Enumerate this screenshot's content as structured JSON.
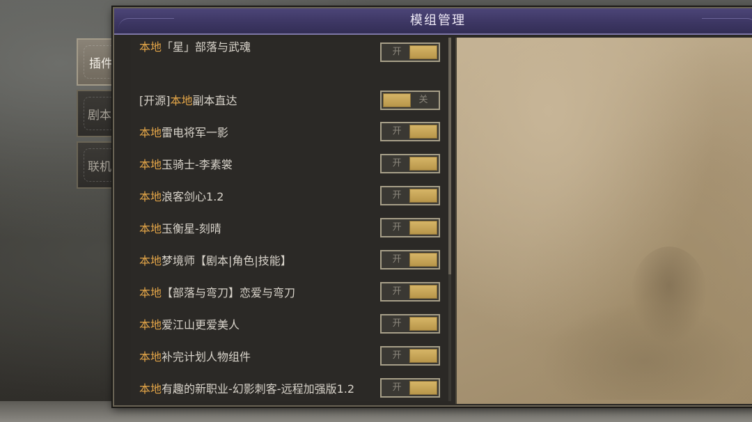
{
  "window": {
    "title": "模组管理"
  },
  "tabs": [
    {
      "label": "插件",
      "active": true
    },
    {
      "label": "剧本",
      "active": false
    },
    {
      "label": "联机",
      "active": false
    }
  ],
  "mods": [
    {
      "prefix": "",
      "highlight": "本地",
      "name": "「星」部落与武魂",
      "state": "on",
      "toggle_label": "开"
    },
    {
      "prefix": "[开源]",
      "highlight": "本地",
      "name": "副本直达",
      "state": "off",
      "toggle_label": "关"
    },
    {
      "prefix": "",
      "highlight": "本地",
      "name": "雷电将军一影",
      "state": "on",
      "toggle_label": "开"
    },
    {
      "prefix": "",
      "highlight": "本地",
      "name": "玉骑士-李素裳",
      "state": "on",
      "toggle_label": "开"
    },
    {
      "prefix": "",
      "highlight": "本地",
      "name": "浪客剑心1.2",
      "state": "on",
      "toggle_label": "开"
    },
    {
      "prefix": "",
      "highlight": "本地",
      "name": "玉衡星-刻晴",
      "state": "on",
      "toggle_label": "开"
    },
    {
      "prefix": "",
      "highlight": "本地",
      "name": "梦境师【剧本|角色|技能】",
      "state": "on",
      "toggle_label": "开"
    },
    {
      "prefix": "",
      "highlight": "本地",
      "name": "【部落与弯刀】恋爱与弯刀",
      "state": "on",
      "toggle_label": "开"
    },
    {
      "prefix": "",
      "highlight": "本地",
      "name": "爱江山更爱美人",
      "state": "on",
      "toggle_label": "开"
    },
    {
      "prefix": "",
      "highlight": "本地",
      "name": "补完计划人物组件",
      "state": "on",
      "toggle_label": "开"
    },
    {
      "prefix": "",
      "highlight": "本地",
      "name": "有趣的新职业-幻影刺客-远程加强版1.2",
      "state": "on",
      "toggle_label": "开"
    }
  ],
  "colors": {
    "highlight": "#e3a548",
    "titlebar": "#3d3764",
    "toggle_knob": "#c9a85a"
  }
}
